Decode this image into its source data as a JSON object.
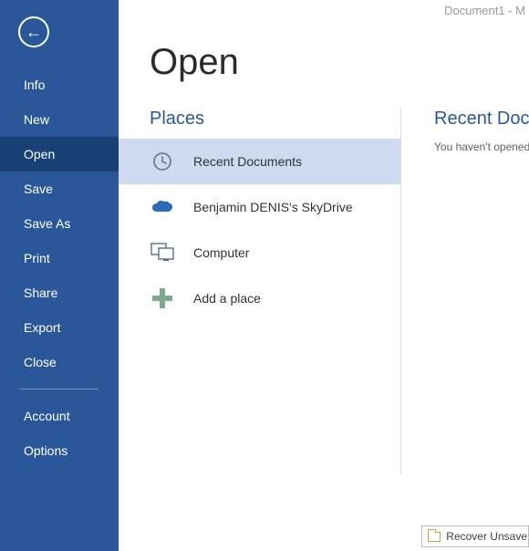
{
  "titlebar": {
    "text": "Document1 - M"
  },
  "sidebar": {
    "items": [
      {
        "label": "Info"
      },
      {
        "label": "New"
      },
      {
        "label": "Open"
      },
      {
        "label": "Save"
      },
      {
        "label": "Save As"
      },
      {
        "label": "Print"
      },
      {
        "label": "Share"
      },
      {
        "label": "Export"
      },
      {
        "label": "Close"
      }
    ],
    "account": "Account",
    "options": "Options"
  },
  "page": {
    "title": "Open"
  },
  "places": {
    "header": "Places",
    "items": [
      {
        "label": "Recent Documents",
        "icon": "recent"
      },
      {
        "label": "Benjamin DENIS's SkyDrive",
        "icon": "skydrive"
      },
      {
        "label": "Computer",
        "icon": "computer"
      },
      {
        "label": "Add a place",
        "icon": "add"
      }
    ]
  },
  "recent": {
    "header": "Recent Doc",
    "body": "You haven't opened"
  },
  "recover": {
    "label": "Recover Unsave"
  }
}
